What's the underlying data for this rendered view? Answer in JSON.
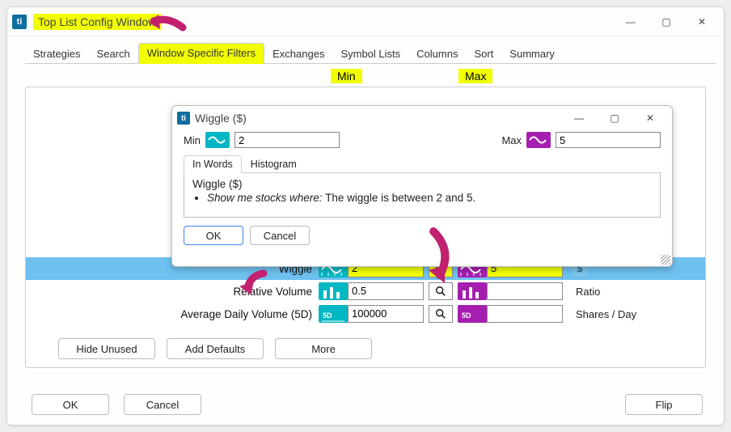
{
  "window": {
    "title": "Top List Config Window",
    "logo_text": "ti",
    "controls": {
      "min": "—",
      "max": "▢",
      "close": "✕"
    }
  },
  "tabs": {
    "items": [
      "Strategies",
      "Search",
      "Window Specific Filters",
      "Exchanges",
      "Symbol Lists",
      "Columns",
      "Sort",
      "Summary"
    ],
    "active_index": 2
  },
  "columns": {
    "min": "Min",
    "max": "Max"
  },
  "filters": [
    {
      "label": "Wiggle",
      "min": "2",
      "max": "5",
      "unit": "$",
      "unit_icon": true,
      "selected": true,
      "highlight": true
    },
    {
      "label": "Relative Volume",
      "min": "0.5",
      "max": "",
      "unit": "Ratio",
      "unit_icon": false,
      "selected": false,
      "highlight": false
    },
    {
      "label": "Average Daily Volume (5D)",
      "min": "100000",
      "max": "",
      "unit": "Shares / Day",
      "unit_icon": false,
      "selected": false,
      "highlight": false
    }
  ],
  "panel_buttons": {
    "hide_unused": "Hide Unused",
    "add_defaults": "Add Defaults",
    "more": "More"
  },
  "window_buttons": {
    "ok": "OK",
    "cancel": "Cancel",
    "flip": "Flip"
  },
  "popup": {
    "title": "Wiggle ($)",
    "min_label": "Min",
    "max_label": "Max",
    "min_value": "2",
    "max_value": "5",
    "tabs": {
      "items": [
        "In Words",
        "Histogram"
      ],
      "active_index": 0
    },
    "heading": "Wiggle ($)",
    "bullet_prefix": "Show me stocks where:",
    "bullet_text": "The wiggle is between 2 and 5.",
    "ok": "OK",
    "cancel": "Cancel"
  },
  "icons": {
    "search": "search-icon",
    "wave": "wave-icon",
    "dollar": "$"
  }
}
